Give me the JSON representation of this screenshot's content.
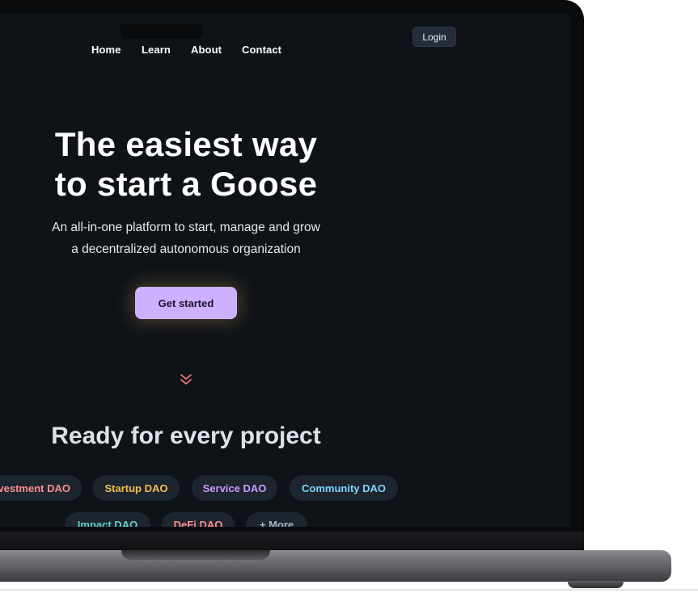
{
  "nav": {
    "items": [
      {
        "label": "Home"
      },
      {
        "label": "Learn"
      },
      {
        "label": "About"
      },
      {
        "label": "Contact"
      }
    ],
    "login_label": "Login"
  },
  "hero": {
    "title_line1": "The easiest way",
    "title_line2": "to start a Goose",
    "subtitle_line1": "An all-in-one platform to start, manage and grow",
    "subtitle_line2": "a decentralized autonomous organization",
    "cta_label": "Get started",
    "scroll_icon": "chevron-double-down-icon"
  },
  "projects": {
    "title": "Ready for every project",
    "chips_row1": [
      {
        "label": "Investment DAO",
        "color": "#ff8f8f"
      },
      {
        "label": "Startup DAO",
        "color": "#f0c04a"
      },
      {
        "label": "Service DAO",
        "color": "#c79bff"
      },
      {
        "label": "Community DAO",
        "color": "#7fd3ff"
      }
    ],
    "chips_row2": [
      {
        "label": "Impact DAO",
        "color": "#5fd0c8"
      },
      {
        "label": "DeFi DAO",
        "color": "#ff8f8f"
      },
      {
        "label": "+ More",
        "color": "#aab4c0"
      }
    ]
  },
  "colors": {
    "screen_bg": "#0f1318",
    "cta_bg": "#cdb0ff",
    "chip_bg": "#1d252f",
    "chevron": "#ff7b7b"
  }
}
